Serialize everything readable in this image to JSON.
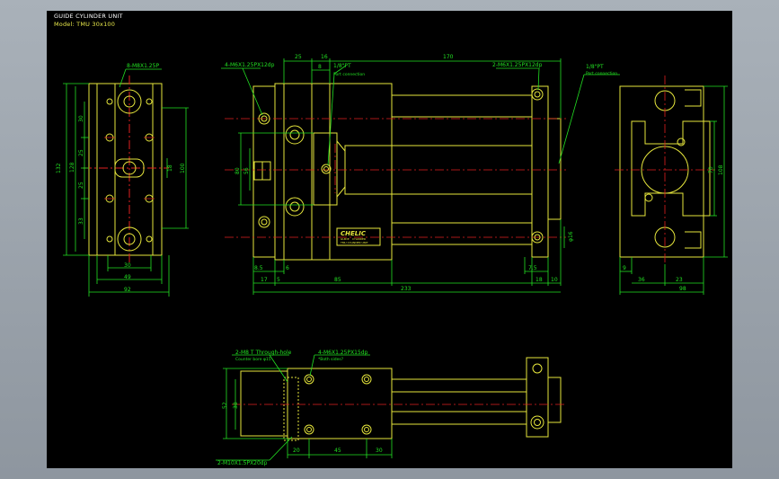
{
  "drawing": {
    "title": "GUIDE CYLINDER UNIT",
    "model": "Model: TMU 30x100"
  },
  "colors": {
    "background": "#000000",
    "outer_background": "#9aa2ab",
    "outline": "#e6e63c",
    "dimension": "#22e022",
    "centerline": "#e02020",
    "label": "#ffffff"
  },
  "left_view": {
    "callout": "8-M8X1.25P",
    "dims_vertical": [
      "30",
      "25",
      "25",
      "33"
    ],
    "dims_overall": [
      "132",
      "128"
    ],
    "dim_right": "100",
    "dim_right_small": "18",
    "dims_bottom": [
      "30",
      "49",
      "92"
    ]
  },
  "front_view": {
    "callout_left": "4-M6X1.25PX12dp",
    "callout_mid_value": "1/8\"PT",
    "callout_mid_sub": "Port connection",
    "callout_right": "2-M6X1.25PX12dp",
    "dims_top": [
      "25",
      "16",
      "8",
      "170"
    ],
    "dims_left": [
      "80",
      "56"
    ],
    "dim_rod": "φ16",
    "dims_bottom": [
      "8.5",
      "6",
      "17",
      "5",
      "85",
      "7.5",
      "18",
      "10",
      "233"
    ],
    "logo": "CHELIC",
    "plate_text_1": "GUIDE",
    "plate_text_2": "CYLINDER",
    "plate_text_3": "TMU CYLINDER UNIT"
  },
  "right_view": {
    "callout_value": "1/8\"PT",
    "callout_sub": "Port connection",
    "dims_right": [
      "70",
      "108"
    ],
    "dims_bottom": [
      "9",
      "36",
      "23",
      "98"
    ]
  },
  "bottom_view": {
    "callout_left": "2-M8 T  Through-hole",
    "callout_left_sub": "Counter bore  φ15",
    "callout_right": "4-M6X1.25PX15dp",
    "callout_right_sub": "*Both sides?",
    "dims_left": [
      "52",
      "38"
    ],
    "dims_bottom": [
      "20",
      "45",
      "30"
    ],
    "callout_bottom": "2-M10X1.5PX20dp"
  }
}
